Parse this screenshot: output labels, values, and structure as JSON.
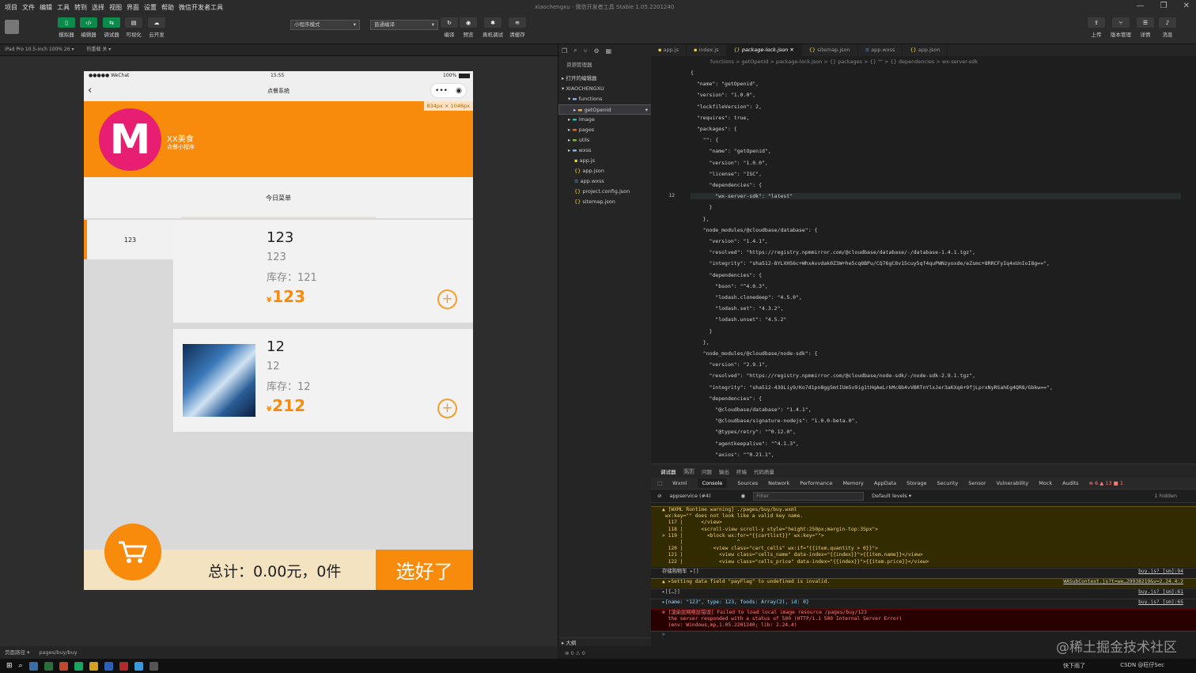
{
  "menubar": {
    "items": [
      "项目",
      "文件",
      "编辑",
      "工具",
      "转到",
      "选择",
      "视图",
      "界面",
      "设置",
      "帮助",
      "微信开发者工具"
    ],
    "app_title": "xiaochengxu - 微信开发者工具 Stable 1.05.2201240"
  },
  "toolbar": {
    "left_labels": [
      "模拟器",
      "编辑器",
      "调试器",
      "可视化",
      "云开发"
    ],
    "compile_mode": "小程序模式",
    "compile_type": "普通编译",
    "center_labels": [
      "编译",
      "预览",
      "真机调试",
      "清缓存"
    ],
    "right_labels": [
      "上传",
      "版本管理",
      "详情",
      "消息"
    ]
  },
  "simulator_bar": {
    "device": "iPad Pro 10.5-inch 100% 26 ▾",
    "hot_reload": "热重载 关 ▾"
  },
  "phone": {
    "status_left": "●●●●● WeChat",
    "status_time": "15:55",
    "status_battery": "100%",
    "nav_title": "点餐系统",
    "capsule_more": "•••",
    "capsule_close": "◉",
    "size_badge": "834px × 1048px",
    "shop_name": "XX美食",
    "shop_sub": "点餐小程序",
    "logo_letter": "M",
    "tab_label": "今日菜单",
    "left_category": "123",
    "foods": [
      {
        "name": "123",
        "desc": "123",
        "stock_label": "库存：",
        "stock": "121",
        "currency": "¥",
        "price": "123"
      },
      {
        "name": "12",
        "desc": "12",
        "stock_label": "库存：",
        "stock": "12",
        "currency": "¥",
        "price": "212"
      }
    ],
    "plus_icon": "+",
    "total_text": "总计：0.00元，0件",
    "done_label": "选好了"
  },
  "bottom_status": {
    "path_label": "页面路径 ▾",
    "path": "pages/buy/buy"
  },
  "explorer": {
    "header": "资源管理器",
    "open_editors": "打开的编辑器",
    "project": "XIAOCHENGXU",
    "items": [
      "functions",
      "getOpenid",
      "image",
      "pages",
      "utils",
      "wxss",
      "app.js",
      "app.json",
      "app.wxss",
      "project.config.json",
      "sitemap.json"
    ],
    "outline": "大纲",
    "problems": "⊗ 0 ⚠ 0"
  },
  "editor": {
    "tabs": [
      "app.js",
      "index.js",
      "package-lock.json",
      "sitemap.json",
      "app.wxss",
      "app.json"
    ],
    "breadcrumb": "functions > getOpenid > package-lock.json > {} packages > {} \"\" > {} dependencies > wx-server-sdk",
    "lines": [
      "{",
      "  \"name\": \"getOpenid\",",
      "  \"version\": \"1.0.0\",",
      "  \"lockfileVersion\": 2,",
      "  \"requires\": true,",
      "  \"packages\": {",
      "    \"\": {",
      "      \"name\": \"getOpenid\",",
      "      \"version\": \"1.0.0\",",
      "      \"license\": \"ISC\",",
      "      \"dependencies\": {",
      "        \"wx-server-sdk\": \"latest\"",
      "      }",
      "    },",
      "    \"node_modules/@cloudbase/database\": {",
      "      \"version\": \"1.4.1\",",
      "      \"resolved\": \"https://registry.npmmirror.com/@cloudbase/database/-/database-1.4.1.tgz\",",
      "      \"integrity\": \"sha512-8YLXH56c+WhxAvvdak0Z3W+he5cq8BPu/CQ76gC8v15cuy5qf4quPWNzyoxde/eZsmc+8RRCFyIq4xUnIoI8g==\",",
      "      \"dependencies\": {",
      "        \"bson\": \"^4.0.3\",",
      "        \"lodash.clonedeep\": \"4.5.0\",",
      "        \"lodash.set\": \"4.3.2\",",
      "        \"lodash.unset\": \"4.5.2\"",
      "      }",
      "    },",
      "    \"node_modules/@cloudbase/node-sdk\": {",
      "      \"version\": \"2.9.1\",",
      "      \"resolved\": \"https://registry.npmmirror.com/@cloudbase/node-sdk/-/node-sdk-2.9.1.tgz\",",
      "      \"integrity\": \"sha512-43OLiy9/Ko7d1pn8gg5mtIUm5v9ig1tHqAeLrkMc8b4vVBRTnYlxJer3aKXq6+9fjLprxNyRSahEg4QR8/Gbkw==\",",
      "      \"dependencies\": {",
      "        \"@cloudbase/database\": \"1.4.1\",",
      "        \"@cloudbase/signature-nodejs\": \"1.0.0-beta.0\",",
      "        \"@types/retry\": \"^0.12.0\",",
      "        \"agentkeepalive\": \"^4.1.3\",",
      "        \"axios\": \"^0.21.1\","
    ],
    "current_line": "12"
  },
  "devtools": {
    "top_tabs": [
      "调试器",
      "5,7",
      "问题",
      "输出",
      "终端",
      "代码质量"
    ],
    "tabs": [
      "Wxml",
      "Console",
      "Sources",
      "Network",
      "Performance",
      "Memory",
      "AppData",
      "Storage",
      "Security",
      "Sensor",
      "Vulnerability",
      "Mock",
      "Audits"
    ],
    "counts": "⊗ 6 ▲ 13 ■ 1",
    "context": "appservice (#4)",
    "filter_placeholder": "Filter",
    "levels": "Default levels ▾",
    "hidden": "1 hidden",
    "log1": "▲ [WXML Runtime warning] ./pages/buy/buy.wxml\n wx:key=\"\" does not look like a valid key name.\n  117 |      </view>\n  118 |      <scroll-view scroll-y style=\"height:250px;margin-top:35px\">\n> 119 |        <block wx:for=\"{{cartlist}}\" wx:key=\"\">\n      |                  ^\n  120 |          <view class=\"cart_cells\" wx:if=\"{{item.quantity > 0}}\">\n  121 |            <view class=\"cells_name\" data-index=\"{{index}}\">{{item.name}}</view>\n  122 |            <view class=\"cells_price\" data-index=\"{{index}}\">{{item.price}}</view>",
    "log2": "存储购物车 ▸[]",
    "log2_src": "buy.js? [sm]:94",
    "log3": "▲ ▸Setting data field \"payFlag\" to undefined is invalid.",
    "log3_src": "WASubContext.js?t=we…29938219&v=2.24.4:2",
    "log4": "▸[{…}]",
    "log4_src": "buy.js? [sm]:61",
    "log5": "▸{name: \"123\", type: 123, foods: Array(2), id: 0}",
    "log5_src": "buy.js? [sm]:65",
    "log6": "⊗ [渲染层网络层错误] Failed to load local image resource /pages/buy/123\n  the server responded with a status of 500 (HTTP/1.1 500 Internal Server Error)\n  (env: Windows,mp,1.05.2201240; lib: 2.24.4)",
    "prompt": ">"
  },
  "taskbar": {
    "weather": "快下雨了",
    "clock": "CSDN @旺仔Sec"
  },
  "watermark": "@稀土掘金技术社区",
  "colors": {
    "accent": "#f88a0c",
    "logo": "#e81e72"
  }
}
